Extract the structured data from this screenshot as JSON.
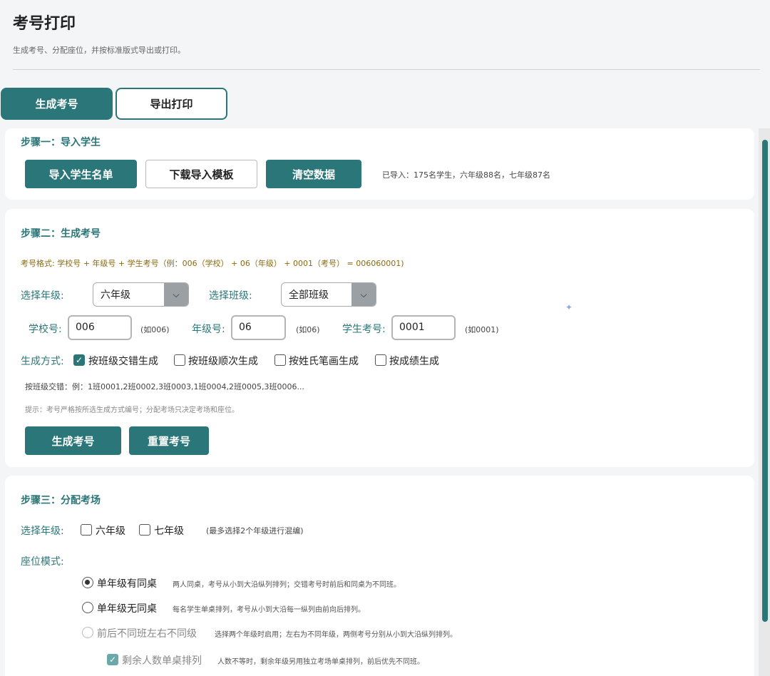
{
  "header": {
    "title": "考号打印",
    "subtitle": "生成考号、分配座位，并按标准版式导出或打印。"
  },
  "tabs": [
    {
      "label": "生成考号",
      "active": true
    },
    {
      "label": "导出打印",
      "active": false
    }
  ],
  "step1": {
    "title": "步骤一：导入学生",
    "import_button": "导入学生名单",
    "template_button": "下载导入模板",
    "clear_button": "清空数据",
    "status": "已导入：175名学生，六年级88名，七年级87名"
  },
  "step2": {
    "title": "步骤二：生成考号",
    "format_text": "考号格式: 学校号 + 年级号 + 学生考号（例：006（学校） + 06（年级） + 0001（考号） = 006060001)",
    "grade_label": "选择年级:",
    "grade_value": "六年级",
    "class_label": "选择班级:",
    "class_value": "全部班级",
    "school_label": "学校号:",
    "school_value": "006",
    "school_hint": "(如006)",
    "gradeno_label": "年级号:",
    "gradeno_value": "06",
    "gradeno_hint": "(如06)",
    "student_label": "学生考号:",
    "student_value": "0001",
    "student_hint": "(如0001)",
    "method_label": "生成方式:",
    "methods": [
      {
        "label": "按班级交错生成",
        "checked": true
      },
      {
        "label": "按班级顺次生成",
        "checked": false
      },
      {
        "label": "按姓氏笔画生成",
        "checked": false
      },
      {
        "label": "按成绩生成",
        "checked": false
      }
    ],
    "example": "按班级交错：例：1班0001,2班0002,3班0003,1班0004,2班0005,3班0006...",
    "tip": "提示：考号严格按所选生成方式编号；分配考场只决定考场和座位。",
    "generate_button": "生成考号",
    "reset_button": "重置考号"
  },
  "step3": {
    "title": "步骤三：分配考场",
    "grade_label": "选择年级:",
    "grades": [
      {
        "label": "六年级",
        "checked": false
      },
      {
        "label": "七年级",
        "checked": false
      }
    ],
    "grade_hint": "(最多选择2个年级进行混编)",
    "seat_label": "座位模式:",
    "modes": [
      {
        "label": "单年级有同桌",
        "desc": "两人同桌，考号从小到大沿纵列排列；交错考号时前后和同桌为不同班。",
        "selected": true,
        "disabled": false
      },
      {
        "label": "单年级无同桌",
        "desc": "每名学生单桌排列，考号从小到大沿每一纵列由前向后排列。",
        "selected": false,
        "disabled": false
      },
      {
        "label": "前后不同班左右不同级",
        "desc": "选择两个年级时启用；左右为不同年级，两侧考号分别从小到大沿纵列排列。",
        "selected": false,
        "disabled": true
      }
    ],
    "remainder_label": "剩余人数单桌排列",
    "remainder_desc": "人数不等时，剩余年级另用独立考场单桌排列，前后优先不同班。"
  },
  "colors": {
    "primary": "#2b7678",
    "format_text": "#8a6a10"
  }
}
